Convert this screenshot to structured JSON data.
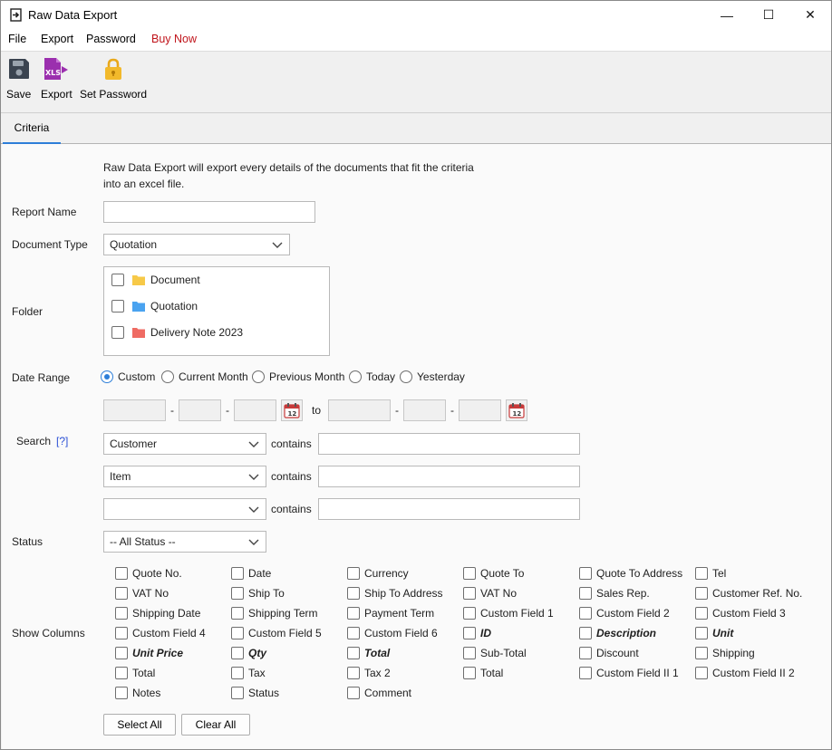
{
  "window": {
    "title": "Raw Data Export",
    "controls": {
      "minimize": "—",
      "maximize": "☐",
      "close": "✕"
    }
  },
  "menu": {
    "items": [
      "File",
      "Export",
      "Password",
      "Buy Now"
    ]
  },
  "toolbar": {
    "save_label": "Save",
    "export_label": "Export",
    "export_icon_text": "XLS",
    "password_label": "Set Password"
  },
  "tabs": [
    {
      "label": "Criteria",
      "active": true
    }
  ],
  "criteria": {
    "description_line1": "Raw Data Export will export every details of the documents that fit the criteria",
    "description_line2": "into an excel file.",
    "report_name": {
      "label": "Report Name",
      "value": ""
    },
    "document_type": {
      "label": "Document Type",
      "value": "Quotation"
    },
    "folder": {
      "label": "Folder",
      "items": [
        {
          "name": "Document",
          "color": "#f7c948",
          "checked": false
        },
        {
          "name": "Quotation",
          "color": "#4aa3f0",
          "checked": false
        },
        {
          "name": "Delivery Note 2023",
          "color": "#ef6b63",
          "checked": false
        }
      ]
    },
    "date_range": {
      "label": "Date Range",
      "options": [
        "Custom",
        "Current Month",
        "Previous Month",
        "Today",
        "Yesterday"
      ],
      "selected": "Custom",
      "separator": "-",
      "to_label": "to",
      "calendar_day": "12"
    },
    "search": {
      "label": "Search",
      "help": "[?]",
      "rows": [
        {
          "field": "Customer",
          "op": "contains",
          "value": ""
        },
        {
          "field": "Item",
          "op": "contains",
          "value": ""
        },
        {
          "field": "",
          "op": "contains",
          "value": ""
        }
      ]
    },
    "status": {
      "label": "Status",
      "value": "-- All Status --"
    },
    "show_columns": {
      "label": "Show Columns",
      "columns": [
        [
          {
            "label": "Quote No.",
            "bold": false
          },
          {
            "label": "VAT No",
            "bold": false
          },
          {
            "label": "Shipping Date",
            "bold": false
          },
          {
            "label": "Custom Field 4",
            "bold": false
          },
          {
            "label": "Unit Price",
            "bold": true
          },
          {
            "label": "Total",
            "bold": false
          },
          {
            "label": "Notes",
            "bold": false
          }
        ],
        [
          {
            "label": "Date",
            "bold": false
          },
          {
            "label": "Ship To",
            "bold": false
          },
          {
            "label": "Shipping Term",
            "bold": false
          },
          {
            "label": "Custom Field 5",
            "bold": false
          },
          {
            "label": "Qty",
            "bold": true
          },
          {
            "label": "Tax",
            "bold": false
          },
          {
            "label": "Status",
            "bold": false
          }
        ],
        [
          {
            "label": "Currency",
            "bold": false
          },
          {
            "label": "Ship To Address",
            "bold": false
          },
          {
            "label": "Payment Term",
            "bold": false
          },
          {
            "label": "Custom Field 6",
            "bold": false
          },
          {
            "label": "Total",
            "bold": true
          },
          {
            "label": "Tax 2",
            "bold": false
          },
          {
            "label": "Comment",
            "bold": false
          }
        ],
        [
          {
            "label": "Quote To",
            "bold": false
          },
          {
            "label": "VAT No",
            "bold": false
          },
          {
            "label": "Custom Field 1",
            "bold": false
          },
          {
            "label": "ID",
            "bold": true
          },
          {
            "label": "Sub-Total",
            "bold": false
          },
          {
            "label": "Total",
            "bold": false
          }
        ],
        [
          {
            "label": "Quote To Address",
            "bold": false
          },
          {
            "label": "Sales Rep.",
            "bold": false
          },
          {
            "label": "Custom Field 2",
            "bold": false
          },
          {
            "label": "Description",
            "bold": true
          },
          {
            "label": "Discount",
            "bold": false
          },
          {
            "label": "Custom Field II 1",
            "bold": false
          }
        ],
        [
          {
            "label": "Tel",
            "bold": false
          },
          {
            "label": "Customer Ref. No.",
            "bold": false
          },
          {
            "label": "Custom Field 3",
            "bold": false
          },
          {
            "label": "Unit",
            "bold": true
          },
          {
            "label": "Shipping",
            "bold": false
          },
          {
            "label": "Custom Field II 2",
            "bold": false
          }
        ]
      ],
      "select_all_label": "Select All",
      "clear_all_label": "Clear All"
    }
  },
  "colors": {
    "accent": "#2d7ed8",
    "buy_now": "#c0141b",
    "export_icon": "#9b2fae",
    "lock_icon": "#e9a81a"
  }
}
